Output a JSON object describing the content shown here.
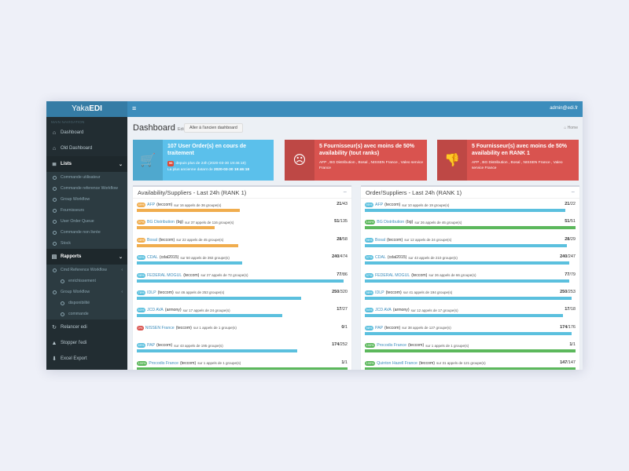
{
  "app": {
    "logo_light": "Yaka",
    "logo_bold": "EDI",
    "user": "admin@edi.fr",
    "menu_icon": "hamburger-icon"
  },
  "sidebar": {
    "header": "MAIN NAVIGATION",
    "items": [
      {
        "label": "Dashboard",
        "icon": "dashboard-icon",
        "glyph": "⌂"
      },
      {
        "label": "Old Dashboard",
        "icon": "dashboard-icon",
        "glyph": "⌂"
      },
      {
        "label": "Lists",
        "icon": "list-icon",
        "glyph": "≣",
        "open": true
      },
      {
        "label": "Rapports",
        "icon": "report-icon",
        "glyph": "▤",
        "open": true
      },
      {
        "label": "Relancer edi",
        "icon": "refresh-icon",
        "glyph": "↻"
      },
      {
        "label": "Stopper l'edi",
        "icon": "warning-icon",
        "glyph": "▲"
      },
      {
        "label": "Excel Export",
        "icon": "download-icon",
        "glyph": "⬇"
      }
    ],
    "lists_sub": [
      "Commande utilisateur",
      "Commande reference Workflow",
      "Group Workflow",
      "Fournisseurs",
      "User Order Queue",
      "Commande non livrée",
      "Stock"
    ],
    "rapports_sub": [
      {
        "label": "Cmd Reference Workflow",
        "children": [
          "enrichissement"
        ]
      },
      {
        "label": "Group Workflow",
        "children": [
          "disponibilité",
          "commande"
        ]
      }
    ]
  },
  "page": {
    "title": "Dashboard",
    "subtitle": "Edi",
    "old_button": "Aller à l'ancien dashboard",
    "breadcrumb": "Home"
  },
  "info_boxes": [
    {
      "title": "107 User Order(s) en cours de traitement",
      "badge": "96",
      "line1": "depuis plus de 24h (2020-03-30 19:46:18)",
      "line2_prefix": "La plus ancienne datant de ",
      "line2_value": "2020-03-30 19:46:18",
      "color": "#5bc0eb",
      "icon": "cart-icon",
      "glyph": "🛒"
    },
    {
      "title": "5 Fournisseur(s) avec moins de 50% availability (tout ranks)",
      "sub": "AFP , BG Distribution , Bosal , NISSEN France , Valeo service France",
      "color": "#d9534f",
      "icon": "sad-face-icon",
      "glyph": "☹"
    },
    {
      "title": "5 Fournisseur(s) avec moins de 50% availability en RANK 1",
      "sub": "AFP , BG Distribution , Bosal , NISSEN France , Valeo service France",
      "color": "#d9534f",
      "icon": "thumbs-down-icon",
      "glyph": "👎"
    }
  ],
  "panels": [
    {
      "title": "Availability/Suppliers - Last 24h (RANK 1)",
      "rows": [
        {
          "pct": "49%",
          "name": "AFP",
          "code": "(teccom)",
          "stat": "sur 16 appels de 36 groupe(s)",
          "done": "21",
          "total": "/43",
          "fill": 0.49,
          "color": "#f0ad4e"
        },
        {
          "pct": "37%",
          "name": "BG Distribution",
          "code": "(bg)",
          "stat": "sur 37 appels de 116 groupe(s)",
          "done": "51",
          "total": "/135",
          "fill": 0.37,
          "color": "#f0ad4e"
        },
        {
          "pct": "48%",
          "name": "Bosal",
          "code": "(teccom)",
          "stat": "sur 22 appels de 45 groupe(s)",
          "done": "28",
          "total": "/58",
          "fill": 0.48,
          "color": "#f0ad4e"
        },
        {
          "pct": "50%",
          "name": "CDAL",
          "code": "(cdal2015)",
          "stat": "sur 50 appels de 392 groupe(s)",
          "done": "240",
          "total": "/474",
          "fill": 0.5,
          "color": "#5bc0de"
        },
        {
          "pct": "98%",
          "name": "FEDERAL MOGUL",
          "code": "(teccom)",
          "stat": "sur 27 appels de 72 groupe(s)",
          "done": "77",
          "total": "/86",
          "fill": 0.98,
          "color": "#5bc0de"
        },
        {
          "pct": "78%",
          "name": "IDLP",
          "code": "(teccom)",
          "stat": "sur 46 appels de 253 groupe(s)",
          "done": "250",
          "total": "/320",
          "fill": 0.78,
          "color": "#5bc0de"
        },
        {
          "pct": "63%",
          "name": "JCD AVA",
          "code": "(armony)",
          "stat": "sur 17 appels de 24 groupe(s)",
          "done": "17",
          "total": "/27",
          "fill": 0.69,
          "color": "#5bc0de"
        },
        {
          "pct": "0%",
          "name": "NISSEN France",
          "code": "(teccom)",
          "stat": "sur 1 appels de 1 groupe(s)",
          "done": "0",
          "total": "/1",
          "fill": 0,
          "color": "#d9534f"
        },
        {
          "pct": "69%",
          "name": "PAP",
          "code": "(teccom)",
          "stat": "sur 43 appels de 195 groupe(s)",
          "done": "174",
          "total": "/252",
          "fill": 0.76,
          "color": "#5bc0de"
        },
        {
          "pct": "100%",
          "name": "Procodis France",
          "code": "(teccom)",
          "stat": "sur 1 appels de 1 groupe(s)",
          "done": "1",
          "total": "/1",
          "fill": 1,
          "color": "#5cb85c"
        }
      ]
    },
    {
      "title": "Order/Suppliers - Last 24h (RANK 1)",
      "rows": [
        {
          "pct": "95%",
          "name": "AFP",
          "code": "(teccom)",
          "stat": "sur 10 appels de 19 groupe(s)",
          "done": "21",
          "total": "/22",
          "fill": 0.95,
          "color": "#5bc0de"
        },
        {
          "pct": "100%",
          "name": "BG Distribution",
          "code": "(bg)",
          "stat": "sur 26 appels de 46 groupe(s)",
          "done": "51",
          "total": "/51",
          "fill": 1,
          "color": "#5cb85c"
        },
        {
          "pct": "96%",
          "name": "Bosal",
          "code": "(teccom)",
          "stat": "sur 12 appels de 24 groupe(s)",
          "done": "28",
          "total": "/29",
          "fill": 0.96,
          "color": "#5bc0de"
        },
        {
          "pct": "97%",
          "name": "CDAL",
          "code": "(cdal2015)",
          "stat": "sur 43 appels de 210 groupe(s)",
          "done": "240",
          "total": "/247",
          "fill": 0.97,
          "color": "#5bc0de"
        },
        {
          "pct": "97%",
          "name": "FEDERAL MOGUL",
          "code": "(teccom)",
          "stat": "sur 26 appels de 66 groupe(s)",
          "done": "77",
          "total": "/79",
          "fill": 0.97,
          "color": "#5bc0de"
        },
        {
          "pct": "98%",
          "name": "IDLP",
          "code": "(teccom)",
          "stat": "sur 41 appels de 194 groupe(s)",
          "done": "250",
          "total": "/253",
          "fill": 0.98,
          "color": "#5bc0de"
        },
        {
          "pct": "94%",
          "name": "JCD AVA",
          "code": "(armony)",
          "stat": "sur 12 appels de 17 groupe(s)",
          "done": "17",
          "total": "/18",
          "fill": 0.94,
          "color": "#5bc0de"
        },
        {
          "pct": "98%",
          "name": "PAP",
          "code": "(teccom)",
          "stat": "sur 38 appels de 127 groupe(s)",
          "done": "174",
          "total": "/176",
          "fill": 0.98,
          "color": "#5bc0de"
        },
        {
          "pct": "100%",
          "name": "Procodis France",
          "code": "(teccom)",
          "stat": "sur 1 appels de 1 groupe(s)",
          "done": "1",
          "total": "/1",
          "fill": 1,
          "color": "#5cb85c"
        },
        {
          "pct": "100%",
          "name": "Quinton Hazell France",
          "code": "(teccom)",
          "stat": "sur 31 appels de 121 groupe(s)",
          "done": "147",
          "total": "/147",
          "fill": 1,
          "color": "#5cb85c"
        }
      ]
    }
  ]
}
